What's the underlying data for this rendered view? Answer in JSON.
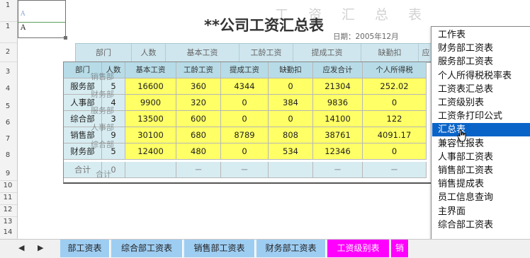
{
  "sheet": {
    "row_numbers": [
      "1",
      "1",
      "2",
      "3",
      "4",
      "5",
      "6",
      "7",
      "8",
      "9",
      "10",
      "11",
      "12",
      "13",
      "14"
    ],
    "namebox": {
      "line1": "A",
      "line2": "A"
    },
    "bg_title": "工资汇总表",
    "title": "**公司工资汇总表",
    "date_label": "日期：2005年12月"
  },
  "upper_headers": [
    "部门",
    "人数",
    "基本工资",
    "工龄工资",
    "提成工资",
    "缺勤扣",
    "应"
  ],
  "table": {
    "headers": [
      "部门",
      "人数",
      "基本工资",
      "工龄工资",
      "提成工资",
      "缺勤扣",
      "应发合计",
      "个人所得税"
    ],
    "rows": [
      [
        "服务部",
        "5",
        "16600",
        "360",
        "4344",
        "0",
        "21304",
        "252.02"
      ],
      [
        "人事部",
        "4",
        "9900",
        "320",
        "0",
        "384",
        "9836",
        "0"
      ],
      [
        "综合部",
        "3",
        "13500",
        "600",
        "0",
        "0",
        "14100",
        "122"
      ],
      [
        "销售部",
        "9",
        "30100",
        "680",
        "8789",
        "808",
        "38761",
        "4091.17"
      ],
      [
        "财务部",
        "5",
        "12400",
        "480",
        "0",
        "534",
        "12346",
        "0"
      ]
    ],
    "total_row": [
      "合计",
      "0",
      "",
      "－",
      "－",
      "",
      "－",
      "－"
    ],
    "ghost_labels": [
      "销售部",
      "财务部",
      "服务部",
      "人事部",
      "综合部",
      "合计"
    ]
  },
  "dropdown": {
    "items": [
      "工作表",
      "财务部工资表",
      "服务部工资表",
      "个人所得税税率表",
      "工资表汇总表",
      "工资级别表",
      "工资条打印公式",
      "汇总表",
      "兼容性报表",
      "人事部工资表",
      "销售部工资表",
      "销售提成表",
      "员工信息查询",
      "主界面",
      "综合部工资表"
    ],
    "selected_index": 7,
    "scroll_arrow": "<"
  },
  "tabs": {
    "nav_prev": "◀",
    "nav_next": "▶",
    "items": [
      {
        "label": "部工资表",
        "color": "#9ecdf2"
      },
      {
        "label": "综合部工资表",
        "color": "#9ecdf2"
      },
      {
        "label": "销售部工资表",
        "color": "#9ecdf2"
      },
      {
        "label": "财务部工资表",
        "color": "#9ecdf2"
      },
      {
        "label": "工资级别表",
        "color": "#ff00ff"
      },
      {
        "label": "销",
        "color": "#ff00ff"
      }
    ]
  },
  "colors": {
    "yellow_cells": "#ffff66",
    "header_blue": "#b7dce8",
    "selection_blue": "#0a64c8",
    "magenta_tab": "#ff00ff"
  }
}
